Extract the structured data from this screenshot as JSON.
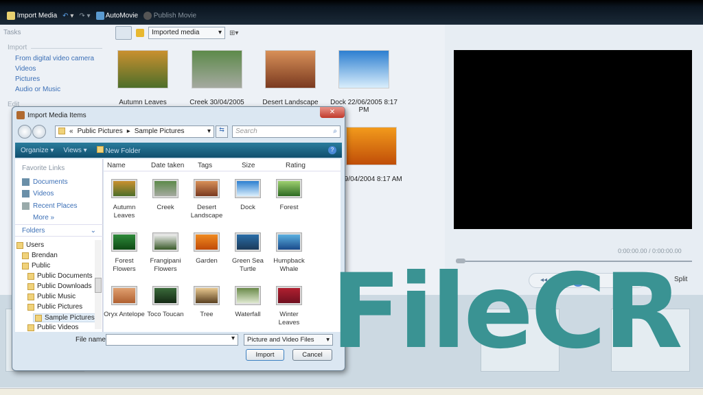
{
  "toolbar": {
    "import_media": "Import Media",
    "automovie": "AutoMovie",
    "publish_movie": "Publish Movie"
  },
  "tasks": {
    "heading": "Tasks",
    "import_heading": "Import",
    "edit_heading": "Edit",
    "links": [
      "From digital video camera",
      "Videos",
      "Pictures",
      "Audio or Music"
    ]
  },
  "content": {
    "view_combo": "Imported media",
    "items": [
      {
        "caption": "Autumn Leaves",
        "colors": [
          "#c9902f",
          "#4d6e2a"
        ]
      },
      {
        "caption": "Creek 30/04/2005 11:20",
        "colors": [
          "#5d8a4a",
          "#a5a9a0"
        ]
      },
      {
        "caption": "Desert Landscape",
        "colors": [
          "#d89058",
          "#7a3a20"
        ]
      },
      {
        "caption": "Dock 22/06/2005 8:17 PM",
        "colors": [
          "#2d7fd0",
          "#d9eefc"
        ]
      },
      {
        "caption": "09/04/2004 8:17 AM",
        "colors": [
          "#f29a1c",
          "#c04e08"
        ]
      }
    ]
  },
  "preview": {
    "time": "0:00:00.00 / 0:00:00.00",
    "split": "Split",
    "seek_progress": 0
  },
  "dialog": {
    "title": "Import Media Items",
    "address": [
      "«",
      "Public Pictures",
      "▸",
      "Sample Pictures"
    ],
    "search_placeholder": "Search",
    "commands": [
      "Organize ▾",
      "Views ▾",
      "New Folder"
    ],
    "favorite_links_heading": "Favorite Links",
    "favorite_links": [
      "Documents",
      "Videos",
      "Recent Places"
    ],
    "more": "More »",
    "folders_heading": "Folders",
    "tree": [
      {
        "label": "Users",
        "level": 0
      },
      {
        "label": "Brendan",
        "level": 1
      },
      {
        "label": "Public",
        "level": 1
      },
      {
        "label": "Public Documents",
        "level": 2
      },
      {
        "label": "Public Downloads",
        "level": 2
      },
      {
        "label": "Public Music",
        "level": 2
      },
      {
        "label": "Public Pictures",
        "level": 2
      },
      {
        "label": "Sample Pictures",
        "level": 3,
        "selected": true
      },
      {
        "label": "Public Videos",
        "level": 2
      }
    ],
    "columns": [
      "Name",
      "Date taken",
      "Tags",
      "Size",
      "Rating"
    ],
    "files": [
      {
        "name": "Autumn Leaves",
        "colors": [
          "#c9902f",
          "#4d6e2a"
        ]
      },
      {
        "name": "Creek",
        "colors": [
          "#5d8a4a",
          "#a5a9a0"
        ]
      },
      {
        "name": "Desert Landscape",
        "colors": [
          "#d89058",
          "#7a3a20"
        ]
      },
      {
        "name": "Dock",
        "colors": [
          "#2d7fd0",
          "#d9eefc"
        ]
      },
      {
        "name": "Forest",
        "colors": [
          "#9ed070",
          "#2d6a22"
        ]
      },
      {
        "name": "Forest Flowers",
        "colors": [
          "#2e8a3a",
          "#0f4a15"
        ]
      },
      {
        "name": "Frangipani Flowers",
        "colors": [
          "#eee",
          "#3a5a2a"
        ]
      },
      {
        "name": "Garden",
        "colors": [
          "#f08a20",
          "#c04a08"
        ]
      },
      {
        "name": "Green Sea Turtle",
        "colors": [
          "#2a6ea8",
          "#1b3a5a"
        ]
      },
      {
        "name": "Humpback Whale",
        "colors": [
          "#5ab0e0",
          "#1a4a8a"
        ]
      },
      {
        "name": "Oryx Antelope",
        "colors": [
          "#e0a070",
          "#b06030"
        ]
      },
      {
        "name": "Toco Toucan",
        "colors": [
          "#3a6a3a",
          "#152a15"
        ]
      },
      {
        "name": "Tree",
        "colors": [
          "#e8c890",
          "#5a4020"
        ]
      },
      {
        "name": "Waterfall",
        "colors": [
          "#6a8a4a",
          "#dfe8d0"
        ]
      },
      {
        "name": "Winter Leaves",
        "colors": [
          "#b02030",
          "#701020"
        ]
      }
    ],
    "file_name_label": "File name:",
    "file_name_value": "",
    "file_type": "Picture and Video Files",
    "import_button": "Import",
    "cancel_button": "Cancel"
  },
  "watermark": {
    "text": "FileCR",
    "color": "#3a9393"
  }
}
